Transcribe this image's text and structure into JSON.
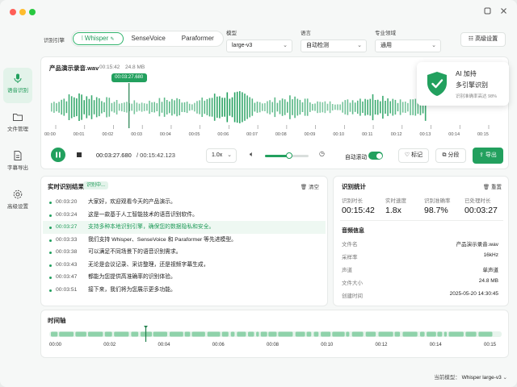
{
  "window": {
    "dots": [
      "#ff5f57",
      "#febc2e",
      "#28c840"
    ],
    "icons": [
      "restore-icon",
      "close-icon"
    ]
  },
  "sidebar": {
    "items": [
      {
        "label": "语音识别",
        "icon": "mic-icon",
        "active": true
      },
      {
        "label": "文件管理",
        "icon": "folder-icon",
        "active": false
      },
      {
        "label": "字幕导出",
        "icon": "document-icon",
        "active": false
      },
      {
        "label": "高级设置",
        "icon": "gear-icon",
        "active": false
      }
    ]
  },
  "topbar": {
    "engine_label": "识别引擎",
    "engines": [
      "Whisper",
      "SenseVoice",
      "Paraformer"
    ],
    "selected_engine": "Whisper",
    "model_label": "模型",
    "model_value": "large-v3",
    "language_label": "语言",
    "language_value": "自动检测",
    "domain_label": "专业领域",
    "domain_value": "通用",
    "advanced_button": "高级设置"
  },
  "player": {
    "file_name": "产品演示录音.wav",
    "duration": "00:15:42",
    "size": "24.8 MB",
    "cursor_time": "00:03:27.680",
    "progress": 0.22,
    "ruler": [
      "00:00",
      "00:01",
      "00:02",
      "00:03",
      "00:04",
      "00:05",
      "00:06",
      "00:07",
      "00:08",
      "00:09",
      "00:10",
      "00:11",
      "00:12",
      "00:13",
      "00:14",
      "00:15"
    ],
    "current_time": "00:03:27.680",
    "total_time": "/ 00:15:42.123",
    "speed": "1.0x",
    "volume": 0.55,
    "autoscroll_label": "自动滚动",
    "autoscroll_on": true,
    "mark_button": "标记",
    "split_button": "分段",
    "export_button": "导出"
  },
  "ai_panel": {
    "title": "AI 加持",
    "subtitle": "多引擎识别",
    "note": "识别准确率高达 98%",
    "accent": "#22a05e"
  },
  "results": {
    "title": "实时识别结果",
    "badge": "识别中...",
    "clear_button": "清空",
    "rows": [
      {
        "time": "00:03:20",
        "text": "大家好，欢迎观看今天的产品演示。",
        "highlight": false
      },
      {
        "time": "00:03:24",
        "text": "这是一款基于人工智能技术的语音识别软件。",
        "highlight": false
      },
      {
        "time": "00:03:27",
        "text": "支持多种本地识别引擎，确保您的数据隐私和安全。",
        "highlight": true
      },
      {
        "time": "00:03:33",
        "text": "我们支持 Whisper、SenseVoice 和 Paraformer 等先进模型。",
        "highlight": false
      },
      {
        "time": "00:03:38",
        "text": "可以满足不同场景下的语音识别需求。",
        "highlight": false
      },
      {
        "time": "00:03:43",
        "text": "无论是会议记录、采访整理，还是视频字幕生成，",
        "highlight": false
      },
      {
        "time": "00:03:47",
        "text": "都能为您提供高准确率的识别体验。",
        "highlight": false
      },
      {
        "time": "00:03:51",
        "text": "接下来，我们将为您展示更多功能。",
        "highlight": false
      }
    ]
  },
  "stats": {
    "title": "识别统计",
    "reset_button": "重置",
    "items": [
      {
        "label": "识别时长",
        "value": "00:15:42"
      },
      {
        "label": "实时速度",
        "value": "1.8x"
      },
      {
        "label": "识别准确率",
        "value": "98.7%"
      },
      {
        "label": "已处理时长",
        "value": "00:03:27"
      }
    ],
    "file_info_title": "音频信息",
    "file_info": [
      {
        "key": "文件名",
        "value": "产品演示录音.wav"
      },
      {
        "key": "采样率",
        "value": "16kHz"
      },
      {
        "key": "声道",
        "value": "单声道"
      },
      {
        "key": "文件大小",
        "value": "24.8 MB"
      },
      {
        "key": "创建时间",
        "value": "2025-05-20 14:30:45"
      }
    ]
  },
  "timeline": {
    "title": "时间轴",
    "ticks": [
      "00:00",
      "00:02",
      "00:04",
      "00:06",
      "00:08",
      "00:10",
      "00:12",
      "00:14",
      "00:15"
    ],
    "progress": 0.22
  },
  "footer": {
    "model_label": "当前模型：",
    "model_value": "Whisper large-v3"
  }
}
